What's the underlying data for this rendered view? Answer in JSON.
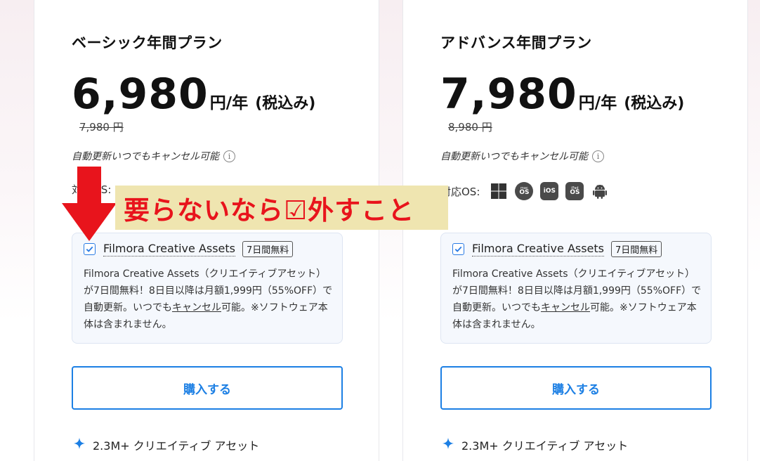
{
  "plans": [
    {
      "title": "ベーシック年間プラン",
      "price": "6,980",
      "price_unit": "円/年",
      "tax_note": "(税込み)",
      "old_price": "7,980 円",
      "autorenew": "自動更新いつでもキャンセル可能",
      "os_label": "対応OS:",
      "addon": {
        "name": "Filmora Creative Assets",
        "trial": "7日間無料",
        "desc_before_link": "Filmora Creative Assets（クリエイティブアセット）が7日間無料！8日目以降は月額1,999円（55%OFF）で自動更新。いつでも",
        "desc_link": "キャンセル",
        "desc_after_link": "可能。※ソフトウェア本体は含まれません。"
      },
      "buy_label": "購入する",
      "feature": "2.3M+ クリエイティブ アセット"
    },
    {
      "title": "アドバンス年間プラン",
      "price": "7,980",
      "price_unit": "円/年",
      "tax_note": "(税込み)",
      "old_price": "8,980 円",
      "autorenew": "自動更新いつでもキャンセル可能",
      "os_label": "対応OS:",
      "addon": {
        "name": "Filmora Creative Assets",
        "trial": "7日間無料",
        "desc_before_link": "Filmora Creative Assets（クリエイティブアセット）が7日間無料！8日目以降は月額1,999円（55%OFF）で自動更新。いつでも",
        "desc_link": "キャンセル",
        "desc_after_link": "可能。※ソフトウェア本体は含まれません。"
      },
      "buy_label": "購入する",
      "feature": "2.3M+ クリエイティブ アセット"
    }
  ],
  "os_icons": [
    "windows-icon",
    "macos-icon",
    "ios-icon",
    "ipados-icon",
    "android-icon"
  ],
  "os_badges": {
    "macos_top": "mac",
    "macos": "OS",
    "ios": "iOS",
    "ipados_top": "iPad",
    "ipados": "OS"
  },
  "info_glyph": "i",
  "annotation": {
    "text": "要らないなら☑外すこと"
  },
  "colors": {
    "accent": "#1c7fe4",
    "annotation_red": "#e8141c",
    "annotation_bg": "#efe5b0"
  }
}
